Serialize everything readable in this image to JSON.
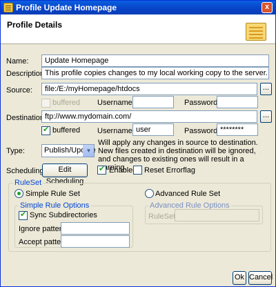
{
  "window": {
    "title": "Profile Update Homepage",
    "close_glyph": "x"
  },
  "header": {
    "title": "Profile Details"
  },
  "form": {
    "name_label": "Name:",
    "name_value": "Update Homepage",
    "description_label": "Description:",
    "description_value": "This profile copies changes to my local working copy to the server.",
    "source_label": "Source:",
    "source_value": "file:/E:/myHomepage/htdocs",
    "source_browse": "...",
    "source_buffered_label": "buffered",
    "source_buffered_checked": false,
    "source_username_label": "Username:",
    "source_username_value": "",
    "source_password_label": "Password:",
    "source_password_value": "",
    "destination_label": "Destination:",
    "destination_value": "ftp://www.mydomain.com/",
    "destination_browse": "...",
    "destination_buffered_label": "buffered",
    "destination_buffered_checked": true,
    "destination_username_label": "Username:",
    "destination_username_value": "user",
    "destination_password_label": "Password:",
    "destination_password_value": "********",
    "type_label": "Type:",
    "type_value": "Publish/Update",
    "type_note": "Will apply any changes in source to destination. New files created in destination will be ignored, and changes to existing ones will result in a warning.",
    "scheduling_label": "Scheduling:",
    "edit_scheduling_label": "Edit Scheduling",
    "enabled_label": "Enabled",
    "enabled_checked": true,
    "reset_errorflag_label": "Reset Errorflag",
    "reset_errorflag_checked": false
  },
  "ruleset": {
    "title": "RuleSet",
    "simple_label": "Simple Rule Set",
    "advanced_label": "Advanced Rule Set",
    "selected": "simple",
    "simple_options_title": "Simple Rule Options",
    "sync_subdirectories_label": "Sync Subdirectories",
    "sync_subdirectories_checked": true,
    "ignore_pattern_label": "Ignore pattern",
    "ignore_pattern_value": "",
    "accept_pattern_label": "Accept pattern",
    "accept_pattern_value": "",
    "advanced_options_title": "Advanced Rule Options",
    "ruleset_field_label": "RuleSet:",
    "ruleset_field_value": ""
  },
  "footer": {
    "ok_label": "Ok",
    "cancel_label": "Cancel"
  },
  "colors": {
    "titlebar": "#0842c6",
    "group_title": "#0046d5",
    "check": "#21a121"
  },
  "icons": [
    "profile-icon",
    "close-icon",
    "document-icon",
    "chevron-down-icon"
  ]
}
